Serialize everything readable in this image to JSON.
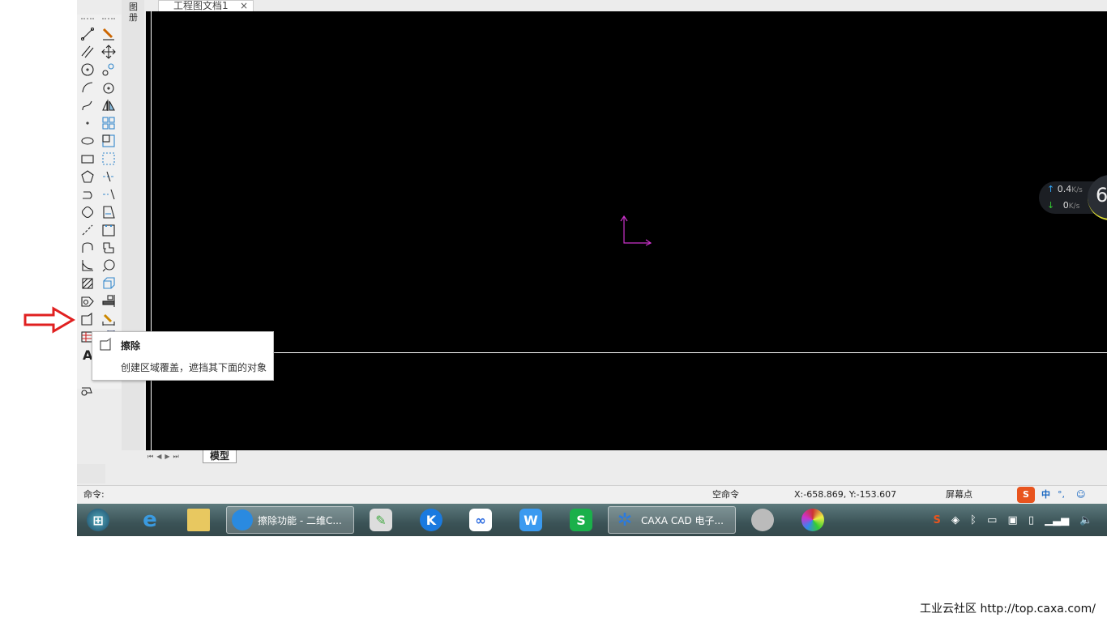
{
  "document_tab": {
    "title": "工程图文档1",
    "close": "×"
  },
  "side_panel": {
    "label": "图册"
  },
  "toolbar": {
    "left": [
      "line",
      "parallel-line",
      "circle",
      "arc",
      "spline",
      "point",
      "ellipse",
      "rectangle",
      "polygon",
      "polyline",
      "cloud-line",
      "centerline",
      "equidistant",
      "curve",
      "hatch",
      "contour",
      "wipeout",
      "table",
      "text",
      "",
      "block"
    ],
    "right": [
      "brush",
      "move",
      "copy",
      "rotate",
      "mirror",
      "array",
      "scale",
      "crop",
      "trim",
      "extend",
      "stretch",
      "break",
      "fillet",
      "zoom",
      "3d-view",
      "align",
      "dimension-edit",
      "dimension",
      "",
      "",
      ""
    ]
  },
  "tooltip": {
    "title": "擦除",
    "description": "创建区域覆盖，遮挡其下面的对象"
  },
  "sheet_tabs": {
    "nav": "⏮◀▶⏭",
    "tabs": [
      "模型"
    ]
  },
  "command_bar": {
    "prompt": "命令:",
    "state": "空命令",
    "coords": "X:-658.869, Y:-153.607",
    "snap": "屏幕点",
    "ime": [
      "中",
      "°,",
      "☺"
    ]
  },
  "network_widget": {
    "up": "0.4",
    "down": "0",
    "unit": "K/s",
    "badge": "6"
  },
  "taskbar": {
    "windows": [
      {
        "label": "擦除功能 - 二维C..."
      },
      {
        "label": "CAXA CAD 电子..."
      }
    ]
  },
  "colors": {
    "canvas": "#000000",
    "ucs": "#cc33cc",
    "arrow": "#e02020"
  },
  "caption": "工业云社区 http://top.caxa.com/"
}
